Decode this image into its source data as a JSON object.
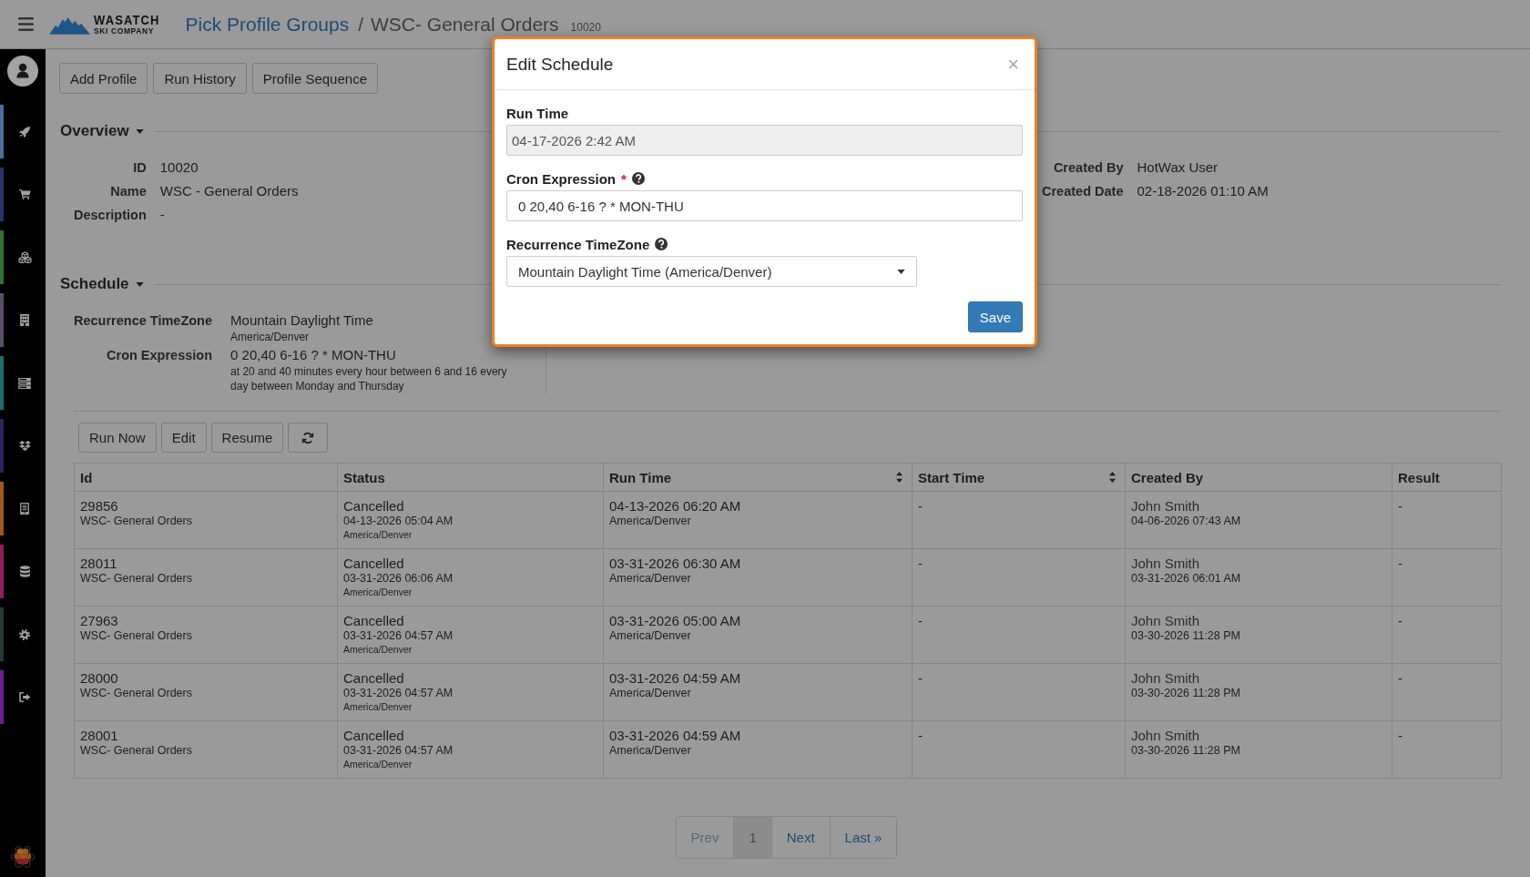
{
  "header": {
    "logo": {
      "name": "WASATCH",
      "tagline": "SKI COMPANY"
    },
    "breadcrumb": "Pick Profile Groups",
    "separator": "/",
    "title": "WSC- General Orders",
    "title_id": "10020"
  },
  "sidebar": {
    "items": [
      {
        "color": "#4b6d9b"
      },
      {
        "color": "#28326b"
      },
      {
        "color": "#2e7430"
      },
      {
        "color": "#5e4d6b"
      },
      {
        "color": "#1c6e70"
      },
      {
        "color": "#2b2661"
      },
      {
        "color": "#a0581e"
      },
      {
        "color": "#8f1f5f"
      },
      {
        "color": "#27383a"
      },
      {
        "color": "#6a1f8f"
      }
    ]
  },
  "toolbar": {
    "buttons": [
      "Add Profile",
      "Run History",
      "Profile Sequence"
    ]
  },
  "overview": {
    "title": "Overview",
    "fields": [
      {
        "label": "ID",
        "value": "10020"
      },
      {
        "label": "Name",
        "value": "WSC - General Orders"
      },
      {
        "label": "Description",
        "value": "-"
      }
    ],
    "side_fields": [
      {
        "label": "Created By",
        "value": "HotWax User"
      },
      {
        "label": "Created Date",
        "value": "02-18-2026 01:10 AM"
      }
    ]
  },
  "schedule": {
    "title": "Schedule",
    "fields": [
      {
        "label": "Recurrence TimeZone",
        "value": "Mountain Daylight Time",
        "note": "America/Denver"
      },
      {
        "label": "Cron Expression",
        "value": "0 20,40 6-16 ? * MON-THU",
        "note": "at 20 and 40 minutes every hour between 6 and 16 every day between Monday and Thursday"
      }
    ]
  },
  "actions": {
    "buttons": [
      "Run Now",
      "Edit",
      "Resume"
    ]
  },
  "table": {
    "columns": [
      {
        "label": "Id",
        "sortable": false
      },
      {
        "label": "Status",
        "sortable": false
      },
      {
        "label": "Run Time",
        "sortable": true
      },
      {
        "label": "Start Time",
        "sortable": true
      },
      {
        "label": "Created By",
        "sortable": false
      },
      {
        "label": "Result",
        "sortable": false
      }
    ],
    "rows": [
      {
        "id": "29856",
        "profile": "WSC- General Orders",
        "status": "Cancelled",
        "status_time": "04-13-2026 05:04 AM",
        "status_zone": "America/Denver",
        "run_time": "04-13-2026 06:20 AM",
        "run_zone": "America/Denver",
        "start_time": "-",
        "created_by": "John Smith",
        "created_date": "04-06-2026 07:43 AM",
        "result": "-"
      },
      {
        "id": "28011",
        "profile": "WSC- General Orders",
        "status": "Cancelled",
        "status_time": "03-31-2026 06:06 AM",
        "status_zone": "America/Denver",
        "run_time": "03-31-2026 06:30 AM",
        "run_zone": "America/Denver",
        "start_time": "-",
        "created_by": "John Smith",
        "created_date": "03-31-2026 06:01 AM",
        "result": "-"
      },
      {
        "id": "27963",
        "profile": "WSC- General Orders",
        "status": "Cancelled",
        "status_time": "03-31-2026 04:57 AM",
        "status_zone": "America/Denver",
        "run_time": "03-31-2026 05:00 AM",
        "run_zone": "America/Denver",
        "start_time": "-",
        "created_by": "John Smith",
        "created_date": "03-30-2026 11:28 PM",
        "result": "-"
      },
      {
        "id": "28000",
        "profile": "WSC- General Orders",
        "status": "Cancelled",
        "status_time": "03-31-2026 04:57 AM",
        "status_zone": "America/Denver",
        "run_time": "03-31-2026 04:59 AM",
        "run_zone": "America/Denver",
        "start_time": "-",
        "created_by": "John Smith",
        "created_date": "03-30-2026 11:28 PM",
        "result": "-"
      },
      {
        "id": "28001",
        "profile": "WSC- General Orders",
        "status": "Cancelled",
        "status_time": "03-31-2026 04:57 AM",
        "status_zone": "America/Denver",
        "run_time": "03-31-2026 04:59 AM",
        "run_zone": "America/Denver",
        "start_time": "-",
        "created_by": "John Smith",
        "created_date": "03-30-2026 11:28 PM",
        "result": "-"
      }
    ]
  },
  "pagination": {
    "items": [
      {
        "label": "Prev",
        "selected": false,
        "disabled": true
      },
      {
        "label": "1",
        "selected": true,
        "disabled": false
      },
      {
        "label": "Next",
        "selected": false,
        "disabled": false
      },
      {
        "label": "Last »",
        "selected": false,
        "disabled": false
      }
    ]
  },
  "modal": {
    "title": "Edit Schedule",
    "close": "×",
    "required_mark": "*",
    "fields": [
      {
        "kind": "text",
        "label": "Run Time",
        "value": "04-17-2026 2:42 AM",
        "disabled": true,
        "required": false,
        "help": false
      },
      {
        "kind": "text",
        "label": "Cron Expression",
        "value": "0 20,40 6-16 ? * MON-THU",
        "disabled": false,
        "required": true,
        "help": true
      },
      {
        "kind": "select",
        "label": "Recurrence TimeZone",
        "value": "Mountain Daylight Time (America/Denver)",
        "disabled": false,
        "required": false,
        "help": true
      }
    ],
    "save": "Save"
  }
}
